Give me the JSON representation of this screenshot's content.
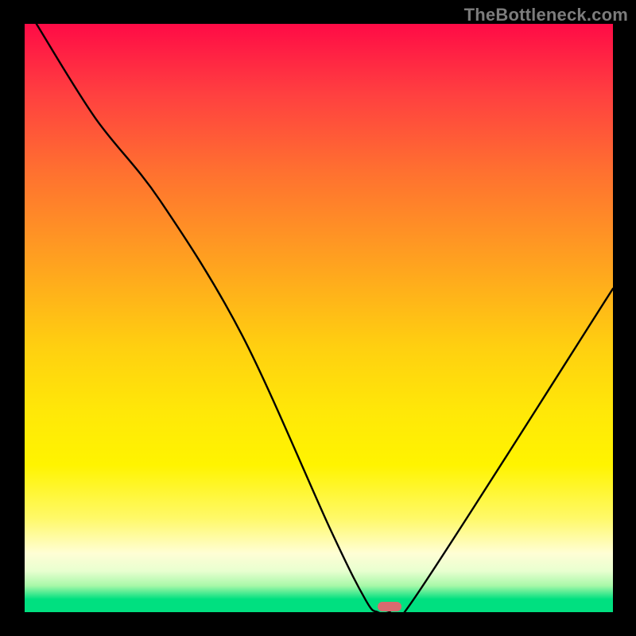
{
  "watermark": "TheBottleneck.com",
  "chart_data": {
    "type": "line",
    "title": "",
    "xlabel": "",
    "ylabel": "",
    "xlim": [
      0,
      100
    ],
    "ylim": [
      0,
      100
    ],
    "series": [
      {
        "name": "bottleneck-curve",
        "x": [
          2,
          12,
          23,
          37,
          52,
          58,
          60,
          62,
          66,
          100
        ],
        "values": [
          100,
          84,
          70,
          47,
          14,
          2,
          0,
          0,
          2,
          55
        ]
      }
    ],
    "marker": {
      "x": 62,
      "y": 1
    },
    "gradient_stops": [
      {
        "pos": 0,
        "color": "#ff0b46"
      },
      {
        "pos": 12,
        "color": "#ff4040"
      },
      {
        "pos": 25,
        "color": "#ff7030"
      },
      {
        "pos": 40,
        "color": "#ffa020"
      },
      {
        "pos": 55,
        "color": "#ffd010"
      },
      {
        "pos": 66,
        "color": "#ffe808"
      },
      {
        "pos": 75,
        "color": "#fff400"
      },
      {
        "pos": 84,
        "color": "#fff968"
      },
      {
        "pos": 90,
        "color": "#fffed5"
      },
      {
        "pos": 93,
        "color": "#e8ffd0"
      },
      {
        "pos": 95.5,
        "color": "#a8f8a8"
      },
      {
        "pos": 97.8,
        "color": "#00e080"
      },
      {
        "pos": 100,
        "color": "#00e080"
      }
    ]
  }
}
